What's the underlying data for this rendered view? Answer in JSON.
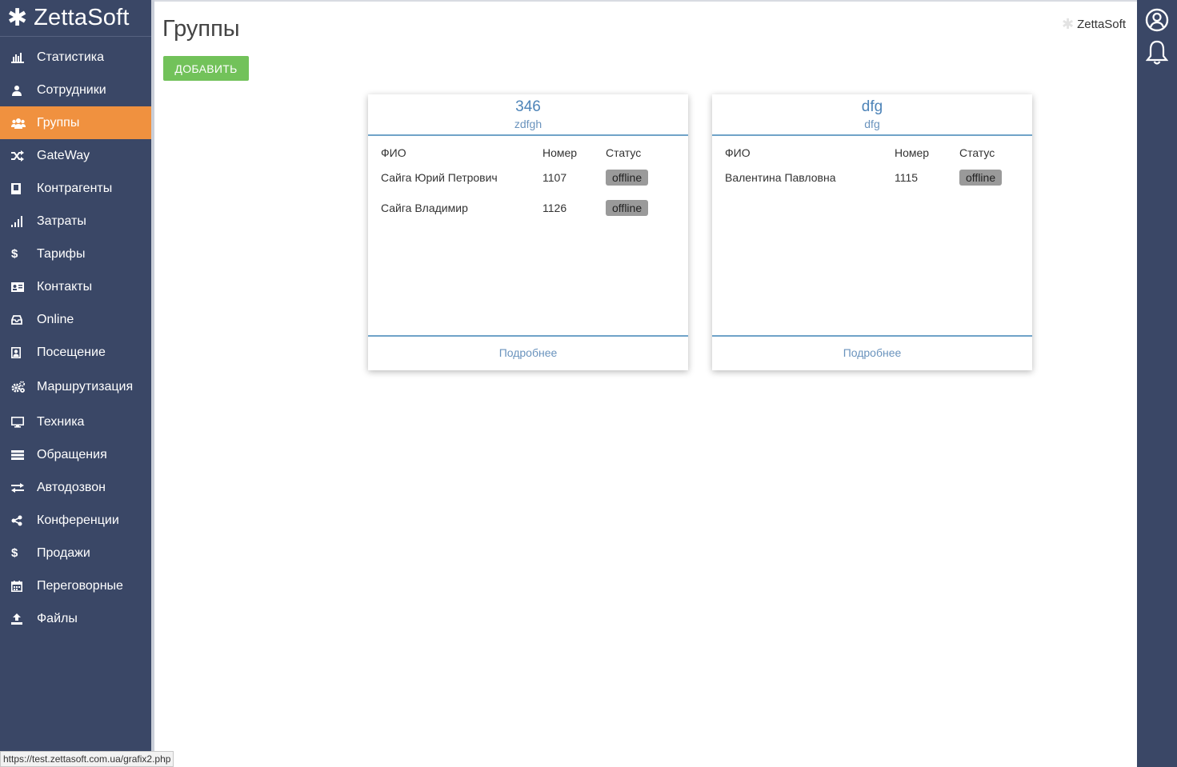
{
  "brand": {
    "logo": "✱",
    "name": "ZettaSoft"
  },
  "sidebar": {
    "items": [
      {
        "icon": "bar-chart-icon",
        "label": "Статистика",
        "active": false
      },
      {
        "icon": "user-icon",
        "label": "Сотрудники",
        "active": false
      },
      {
        "icon": "users-icon",
        "label": "Группы",
        "active": true
      },
      {
        "icon": "shuffle-icon",
        "label": "GateWay",
        "active": false
      },
      {
        "icon": "book-icon",
        "label": "Контрагенты",
        "active": false
      },
      {
        "icon": "signal-icon",
        "label": "Затраты",
        "active": false
      },
      {
        "icon": "dollar-icon",
        "label": "Тарифы",
        "active": false
      },
      {
        "icon": "id-card-icon",
        "label": "Контакты",
        "active": false
      },
      {
        "icon": "inbox-icon",
        "label": "Online",
        "active": false
      },
      {
        "icon": "portrait-icon",
        "label": "Посещение",
        "active": false
      },
      {
        "icon": "gears-icon",
        "label": "Маршрутизация",
        "active": false
      },
      {
        "icon": "monitor-icon",
        "label": "Техника",
        "active": false
      },
      {
        "icon": "list-icon",
        "label": "Обращения",
        "active": false
      },
      {
        "icon": "exchange-icon",
        "label": "Автодозвон",
        "active": false
      },
      {
        "icon": "share-icon",
        "label": "Конференции",
        "active": false
      },
      {
        "icon": "dollar-icon",
        "label": "Продажи",
        "active": false
      },
      {
        "icon": "calendar-icon",
        "label": "Переговорные",
        "active": false
      },
      {
        "icon": "upload-icon",
        "label": "Файлы",
        "active": false
      }
    ]
  },
  "header": {
    "title": "Группы",
    "add_label": "ДОБАВИТЬ",
    "brand_label": "ZettaSoft"
  },
  "cards": [
    {
      "title": "346",
      "subtitle": "zdfgh",
      "columns": [
        "ФИО",
        "Номер",
        "Статус"
      ],
      "rows": [
        {
          "name": "Сайга Юрий Петрович",
          "number": "1107",
          "status": "offline"
        },
        {
          "name": "Сайга Владимир",
          "number": "1126",
          "status": "offline"
        }
      ],
      "more_label": "Подробнее"
    },
    {
      "title": "dfg",
      "subtitle": "dfg",
      "columns": [
        "ФИО",
        "Номер",
        "Статус"
      ],
      "rows": [
        {
          "name": "Валентина Павловна",
          "number": "1115",
          "status": "offline"
        }
      ],
      "more_label": "Подробнее"
    }
  ],
  "rail": {
    "icons": [
      "user-circle-icon",
      "bell-icon"
    ]
  },
  "statusbar": {
    "url": "https://test.zettasoft.com.ua/grafix2.php"
  },
  "colors": {
    "sidebar": "#3a4766",
    "active": "#f0913f",
    "add": "#72c25a",
    "link": "#4e84b8"
  }
}
